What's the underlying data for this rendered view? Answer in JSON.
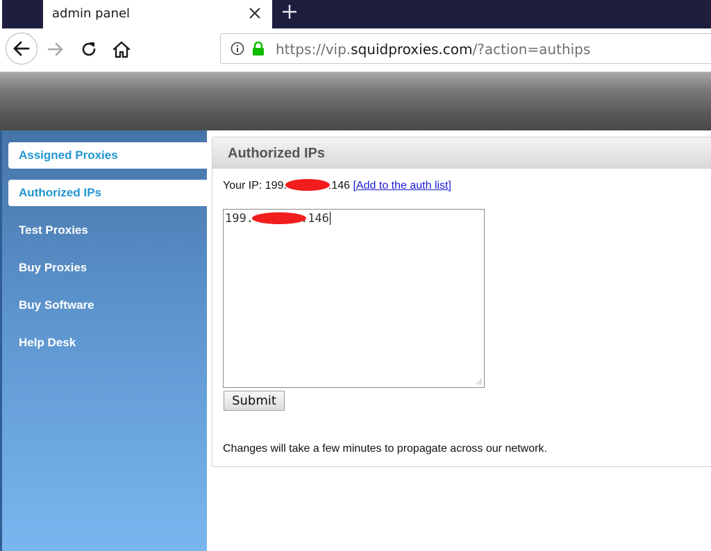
{
  "browser": {
    "tab_title": "admin panel",
    "url": {
      "scheme": "https://",
      "subdomain": "vip.",
      "domain": "squidproxies.com",
      "path": "/?action=authips"
    },
    "icons": [
      "back-arrow-icon",
      "forward-arrow-icon",
      "reload-icon",
      "home-icon",
      "info-icon",
      "lock-icon",
      "close-icon",
      "plus-icon"
    ],
    "colors": {
      "tabstrip": "#1e1e3f",
      "lock": "#12bc00"
    }
  },
  "sidebar": {
    "items": [
      {
        "label": "Assigned Proxies",
        "active": true
      },
      {
        "label": "Authorized IPs",
        "active": true
      },
      {
        "label": "Test Proxies",
        "active": false
      },
      {
        "label": "Buy Proxies",
        "active": false
      },
      {
        "label": "Buy Software",
        "active": false
      },
      {
        "label": "Help Desk",
        "active": false
      }
    ],
    "colors": {
      "active_text": "#2196d0",
      "gradient_top": "#4674a8",
      "gradient_bottom": "#7ab6ef"
    }
  },
  "main": {
    "title": "Authorized IPs",
    "your_ip_label": "Your IP: 199.",
    "your_ip_suffix": ".146",
    "add_link": "[Add to the auth list]",
    "textarea_prefix": "199.",
    "textarea_suffix": ".146",
    "submit_label": "Submit",
    "note": "Changes will take a few minutes to propagate across our network.",
    "colors": {
      "redaction": "#f21d1d",
      "link": "#1a1ad8"
    }
  }
}
